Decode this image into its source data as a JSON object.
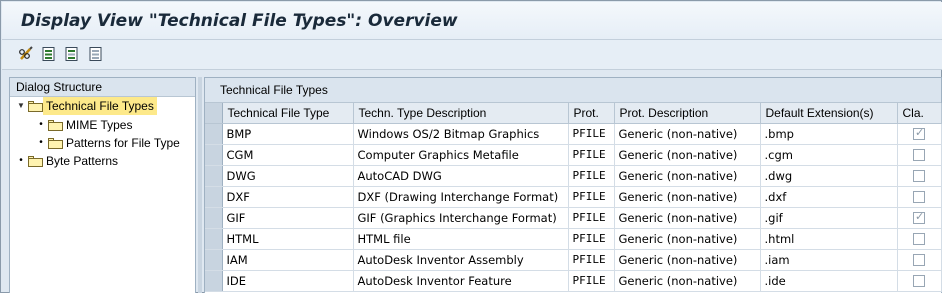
{
  "window": {
    "title": "Display View \"Technical File Types\": Overview"
  },
  "toolbar": {
    "buttons": [
      {
        "icon": "glasses-pencil-icon"
      },
      {
        "icon": "select-all-icon"
      },
      {
        "icon": "select-block-icon"
      },
      {
        "icon": "deselect-all-icon"
      }
    ]
  },
  "dialog_structure": {
    "header": "Dialog Structure",
    "items": [
      {
        "label": "Technical File Types",
        "selected": true,
        "expanded": true,
        "level": 0
      },
      {
        "label": "MIME Types",
        "selected": false,
        "level": 1
      },
      {
        "label": "Patterns for File Type",
        "selected": false,
        "level": 1
      },
      {
        "label": "Byte Patterns",
        "selected": false,
        "level": 0
      }
    ]
  },
  "table": {
    "header": "Technical File Types",
    "columns": [
      "Technical File Type",
      "Techn. Type Description",
      "Prot.",
      "Prot. Description",
      "Default Extension(s)",
      "Cla."
    ],
    "rows": [
      {
        "type": "BMP",
        "desc": "Windows OS/2 Bitmap Graphics",
        "prot": "PFILE",
        "prot_desc": "Generic (non-native)",
        "ext": ".bmp",
        "cla": true
      },
      {
        "type": "CGM",
        "desc": "Computer Graphics Metafile",
        "prot": "PFILE",
        "prot_desc": "Generic (non-native)",
        "ext": ".cgm",
        "cla": false
      },
      {
        "type": "DWG",
        "desc": "AutoCAD DWG",
        "prot": "PFILE",
        "prot_desc": "Generic (non-native)",
        "ext": ".dwg",
        "cla": false
      },
      {
        "type": "DXF",
        "desc": "DXF (Drawing Interchange Format)",
        "prot": "PFILE",
        "prot_desc": "Generic (non-native)",
        "ext": ".dxf",
        "cla": false
      },
      {
        "type": "GIF",
        "desc": "GIF (Graphics Interchange Format)",
        "prot": "PFILE",
        "prot_desc": "Generic (non-native)",
        "ext": ".gif",
        "cla": true
      },
      {
        "type": "HTML",
        "desc": "HTML file",
        "prot": "PFILE",
        "prot_desc": "Generic (non-native)",
        "ext": ".html",
        "cla": false
      },
      {
        "type": "IAM",
        "desc": "AutoDesk Inventor Assembly",
        "prot": "PFILE",
        "prot_desc": "Generic (non-native)",
        "ext": ".iam",
        "cla": false
      },
      {
        "type": "IDE",
        "desc": "AutoDesk Inventor Feature",
        "prot": "PFILE",
        "prot_desc": "Generic (non-native)",
        "ext": ".ide",
        "cla": false
      }
    ]
  }
}
